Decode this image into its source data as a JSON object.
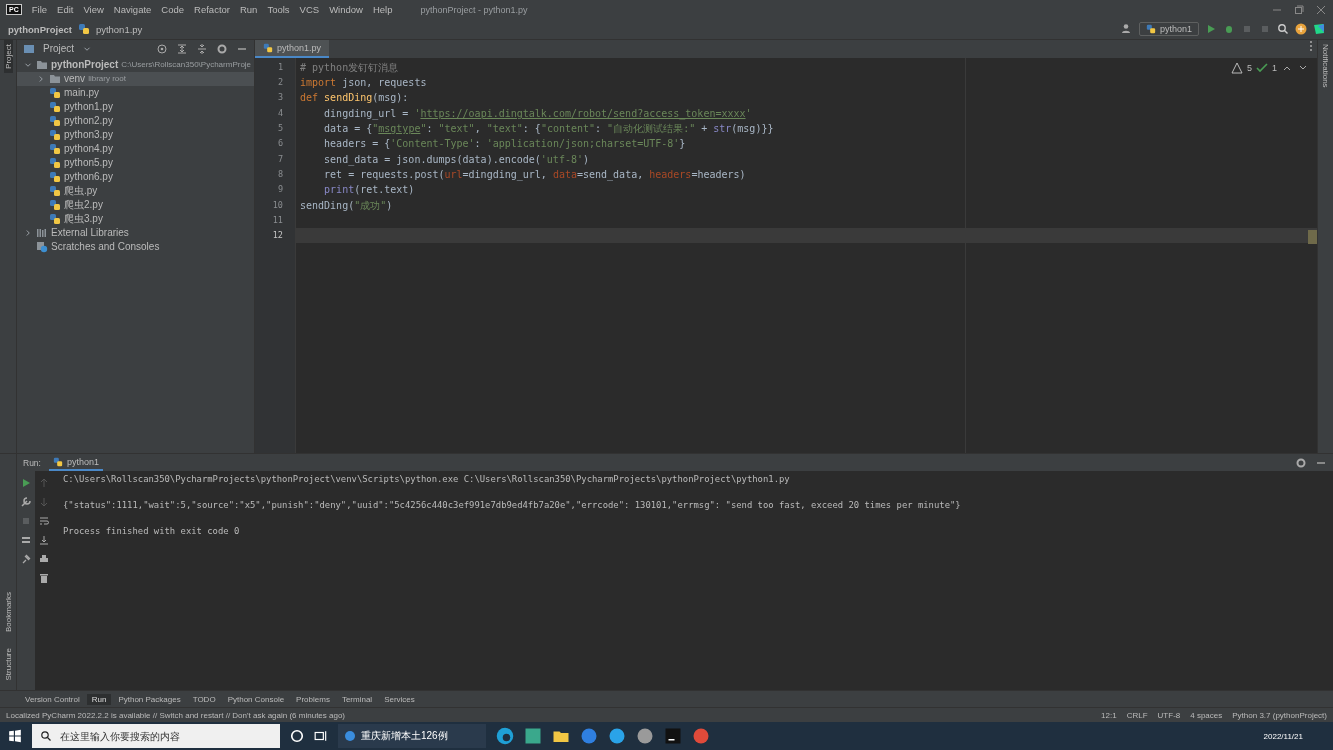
{
  "menu": {
    "logo": "PC",
    "items": [
      "File",
      "Edit",
      "View",
      "Navigate",
      "Code",
      "Refactor",
      "Run",
      "Tools",
      "VCS",
      "Window",
      "Help"
    ],
    "title": "pythonProject - python1.py"
  },
  "breadcrumb": [
    "pythonProject",
    "python1.py"
  ],
  "toolbar": {
    "run_config": "python1"
  },
  "left_strip": {
    "top": "Project",
    "bottom": [
      "Bookmarks",
      "Structure"
    ]
  },
  "right_strip": {
    "label": "Notifications"
  },
  "project_panel": {
    "title": "Project",
    "tree": [
      {
        "label": "pythonProject",
        "hint": "C:\\Users\\Rollscan350\\PycharmProje",
        "kind": "folder",
        "expanded": true,
        "selected": false,
        "children": [
          {
            "label": "venv",
            "hint": "library root",
            "kind": "folder",
            "expanded": false,
            "selected": true
          },
          {
            "label": "main.py",
            "kind": "python",
            "selected": false
          },
          {
            "label": "python1.py",
            "kind": "python",
            "selected": false
          },
          {
            "label": "python2.py",
            "kind": "python",
            "selected": false
          },
          {
            "label": "python3.py",
            "kind": "python",
            "selected": false
          },
          {
            "label": "python4.py",
            "kind": "python",
            "selected": false
          },
          {
            "label": "python5.py",
            "kind": "python",
            "selected": false
          },
          {
            "label": "python6.py",
            "kind": "python",
            "selected": false
          },
          {
            "label": "爬虫.py",
            "kind": "python",
            "selected": false
          },
          {
            "label": "爬虫2.py",
            "kind": "python",
            "selected": false
          },
          {
            "label": "爬虫3.py",
            "kind": "python",
            "selected": false
          }
        ]
      },
      {
        "label": "External Libraries",
        "kind": "libraries",
        "expanded": false,
        "selected": false
      },
      {
        "label": "Scratches and Consoles",
        "kind": "scratches",
        "selected": false
      }
    ]
  },
  "editor": {
    "tabs": [
      {
        "label": "python1.py",
        "selected": true
      }
    ],
    "inspections": {
      "warnings": "5",
      "ok": "1"
    },
    "lines": [
      {
        "number": "1",
        "current": false,
        "tokens": [
          {
            "text": "# python发钉钉消息",
            "kind": "comment"
          }
        ]
      },
      {
        "number": "2",
        "current": false,
        "tokens": [
          {
            "text": "import",
            "kind": "keyword"
          },
          {
            "text": " json, requests",
            "kind": "plain"
          }
        ]
      },
      {
        "number": "3",
        "current": false,
        "tokens": [
          {
            "text": "def ",
            "kind": "keyword"
          },
          {
            "text": "sendDing",
            "kind": "func"
          },
          {
            "text": "(msg):",
            "kind": "plain"
          }
        ]
      },
      {
        "number": "4",
        "current": false,
        "tokens": [
          {
            "text": "    dingding_url = ",
            "kind": "plain"
          },
          {
            "text": "'",
            "kind": "string"
          },
          {
            "text": "https://oapi.dingtalk.com/robot/send?access_token=xxxx",
            "kind": "link"
          },
          {
            "text": "'",
            "kind": "string"
          }
        ]
      },
      {
        "number": "5",
        "current": false,
        "tokens": [
          {
            "text": "    data = {",
            "kind": "plain"
          },
          {
            "text": "\"",
            "kind": "string"
          },
          {
            "text": "msgtype",
            "kind": "link"
          },
          {
            "text": "\"",
            "kind": "string"
          },
          {
            "text": ": ",
            "kind": "plain"
          },
          {
            "text": "\"text\"",
            "kind": "string"
          },
          {
            "text": ", ",
            "kind": "plain"
          },
          {
            "text": "\"text\"",
            "kind": "string"
          },
          {
            "text": ": {",
            "kind": "plain"
          },
          {
            "text": "\"content\"",
            "kind": "string"
          },
          {
            "text": ": ",
            "kind": "plain"
          },
          {
            "text": "\"自动化测试结果:\"",
            "kind": "string"
          },
          {
            "text": " + ",
            "kind": "plain"
          },
          {
            "text": "str",
            "kind": "builtin"
          },
          {
            "text": "(msg)}}",
            "kind": "plain"
          }
        ]
      },
      {
        "number": "6",
        "current": false,
        "tokens": [
          {
            "text": "    headers = {",
            "kind": "plain"
          },
          {
            "text": "'Content-Type'",
            "kind": "string"
          },
          {
            "text": ": ",
            "kind": "plain"
          },
          {
            "text": "'application/json;charset=UTF-8'",
            "kind": "string"
          },
          {
            "text": "}",
            "kind": "plain"
          }
        ]
      },
      {
        "number": "7",
        "current": false,
        "tokens": [
          {
            "text": "    send_data = json.dumps(data).encode(",
            "kind": "plain"
          },
          {
            "text": "'utf-8'",
            "kind": "string"
          },
          {
            "text": ")",
            "kind": "plain"
          }
        ]
      },
      {
        "number": "8",
        "current": false,
        "tokens": [
          {
            "text": "    ret = requests.post(",
            "kind": "plain"
          },
          {
            "text": "url",
            "kind": "param"
          },
          {
            "text": "=dingding_url, ",
            "kind": "plain"
          },
          {
            "text": "data",
            "kind": "param"
          },
          {
            "text": "=send_data, ",
            "kind": "plain"
          },
          {
            "text": "headers",
            "kind": "param"
          },
          {
            "text": "=headers)",
            "kind": "plain"
          }
        ]
      },
      {
        "number": "9",
        "current": false,
        "tokens": [
          {
            "text": "    print",
            "kind": "builtin"
          },
          {
            "text": "(ret.text)",
            "kind": "plain"
          }
        ]
      },
      {
        "number": "10",
        "current": false,
        "tokens": [
          {
            "text": "sendDing(",
            "kind": "plain"
          },
          {
            "text": "\"成功\"",
            "kind": "string"
          },
          {
            "text": ")",
            "kind": "plain"
          }
        ]
      },
      {
        "number": "11",
        "current": false
      },
      {
        "number": "12",
        "current": true
      }
    ]
  },
  "run_panel": {
    "label": "Run:",
    "tabs": [
      {
        "label": "python1",
        "selected": true
      }
    ],
    "output": [
      "C:\\Users\\Rollscan350\\PycharmProjects\\pythonProject\\venv\\Scripts\\python.exe C:\\Users\\Rollscan350\\PycharmProjects\\pythonProject\\python1.py",
      "{\"status\":1111,\"wait\":5,\"source\":\"x5\",\"punish\":\"deny\",\"uuid\":\"5c4256c440c3ef991e7db9ed4fb7a20e\",\"errcode\": 130101,\"errmsg\": \"send too fast, exceed 20 times per minute\"}",
      "Process finished with exit code 0"
    ]
  },
  "bottom_tabs": [
    {
      "label": "Version Control",
      "selected": false
    },
    {
      "label": "Run",
      "selected": true
    },
    {
      "label": "Python Packages",
      "selected": false
    },
    {
      "label": "TODO",
      "selected": false
    },
    {
      "label": "Python Console",
      "selected": false
    },
    {
      "label": "Problems",
      "selected": false
    },
    {
      "label": "Terminal",
      "selected": false
    },
    {
      "label": "Services",
      "selected": false
    }
  ],
  "status_bar": {
    "message": "Localized PyCharm 2022.2.2 is available // Switch and restart // Don't ask again (6 minutes ago)",
    "items": [
      "12:1",
      "CRLF",
      "UTF-8",
      "4 spaces",
      "Python 3.7 (pythonProject)"
    ]
  },
  "taskbar": {
    "search": {
      "placeholder": "在这里输入你要搜索的内容"
    },
    "news": "重庆新增本土126例",
    "date": "2022/11/21"
  }
}
